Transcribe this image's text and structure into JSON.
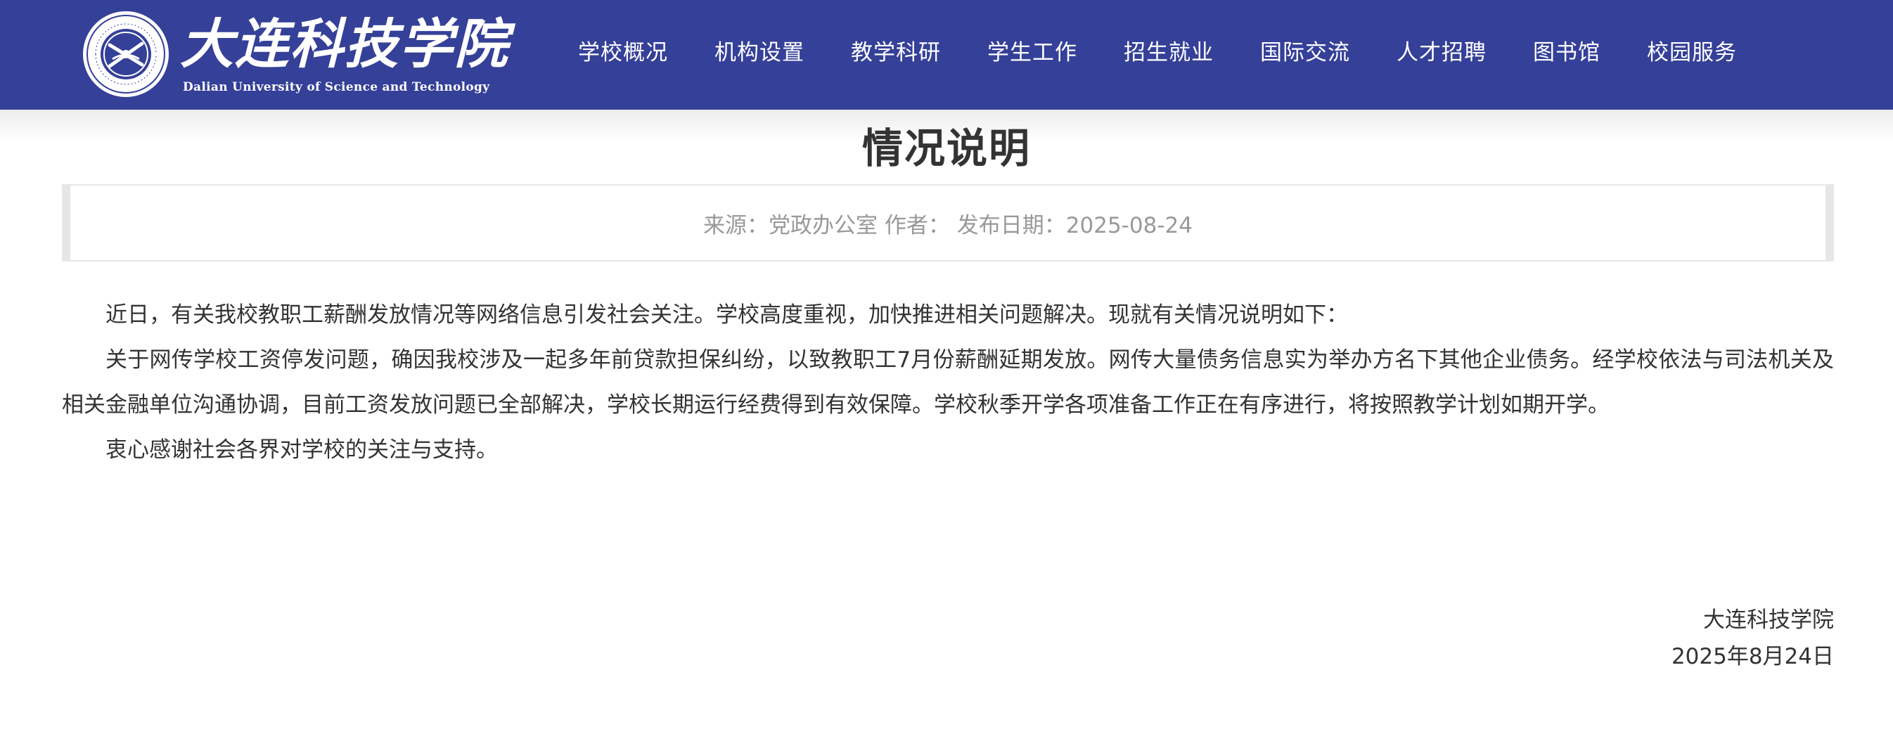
{
  "header": {
    "logo_name": "大连科技学院",
    "logo_en": "Dalian University of Science and Technology",
    "nav": [
      "学校概况",
      "机构设置",
      "教学科研",
      "学生工作",
      "招生就业",
      "国际交流",
      "人才招聘",
      "图书馆",
      "校园服务"
    ],
    "colors": {
      "header_bg": "#354098",
      "nav_text": "#ffffff"
    }
  },
  "article": {
    "title": "情况说明",
    "meta": "来源：党政办公室 作者：  发布日期：2025-08-24",
    "paragraphs": [
      "近日，有关我校教职工薪酬发放情况等网络信息引发社会关注。学校高度重视，加快推进相关问题解决。现就有关情况说明如下：",
      "关于网传学校工资停发问题，确因我校涉及一起多年前贷款担保纠纷，以致教职工7月份薪酬延期发放。网传大量债务信息实为举办方名下其他企业债务。经学校依法与司法机关及相关金融单位沟通协调，目前工资发放问题已全部解决，学校长期运行经费得到有效保障。学校秋季开学各项准备工作正在有序进行，将按照教学计划如期开学。",
      "衷心感谢社会各界对学校的关注与支持。"
    ],
    "signature": {
      "org": "大连科技学院",
      "date": "2025年8月24日"
    }
  },
  "icons": {
    "emblem": "university-emblem-icon"
  }
}
